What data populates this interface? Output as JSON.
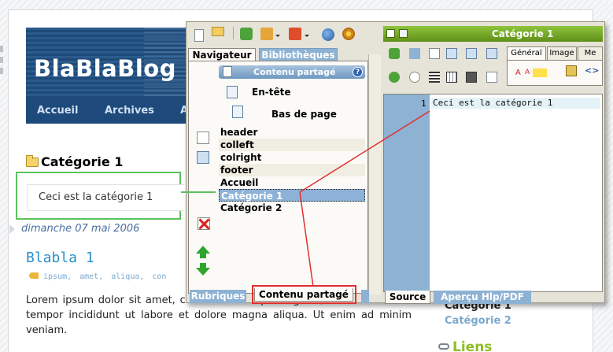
{
  "blog": {
    "title": "BlaBlaBlog",
    "nav": [
      "Accueil",
      "Archives",
      "A"
    ],
    "category_heading": "Catégorie 1",
    "category_text": "Ceci est la catégorie 1",
    "post_date": "dimanche 07 mai 2006",
    "post_title": "Blabla 1",
    "tags": [
      "ipsum,",
      "amet,",
      "aliqua,",
      "con"
    ],
    "post_body": "Lorem ipsum dolor sit amet, consectetur adipisicing elit, sed do eiusmod tempor incididunt ut labore et dolore magna aliqua. Ut enim ad minim veniam.",
    "sidebar_categories": [
      "Catégorie 1",
      "Catégorie 2"
    ],
    "sidebar_links": "Liens"
  },
  "editor": {
    "left_tabs": [
      "Navigateur",
      "Bibliothèques"
    ],
    "shared_content_header": "Contenu partagé",
    "help_label": "?",
    "sub_items": [
      "En-tête",
      "Bas de page"
    ],
    "nav_items": [
      "header",
      "colleft",
      "colright",
      "footer",
      "Accueil",
      "Catégorie 1",
      "Catégorie 2"
    ],
    "selected_item": "Catégorie 1",
    "bottom_tabs_left": [
      "Rubriques",
      "Contenu partagé"
    ],
    "right_title": "Catégorie 1",
    "right_tabs": [
      "Général",
      "Image",
      "Me"
    ],
    "line_number": "1",
    "code_line": "Ceci est la catégorie 1",
    "bottom_tabs_right": [
      "Source",
      "Aperçu Hlp/PDF"
    ]
  },
  "colors": {
    "accent_blue": "#8db2d3",
    "green_outline": "#5cc25c",
    "red_highlight": "#e03030",
    "title_green": "#6fa026"
  },
  "icons": [
    "new-document-icon",
    "open-folder-icon",
    "tools-icon",
    "wizard-icon",
    "globe-icon",
    "gear-icon",
    "delete-icon",
    "move-up-icon",
    "move-down-icon",
    "help-icon",
    "bold-icon"
  ]
}
